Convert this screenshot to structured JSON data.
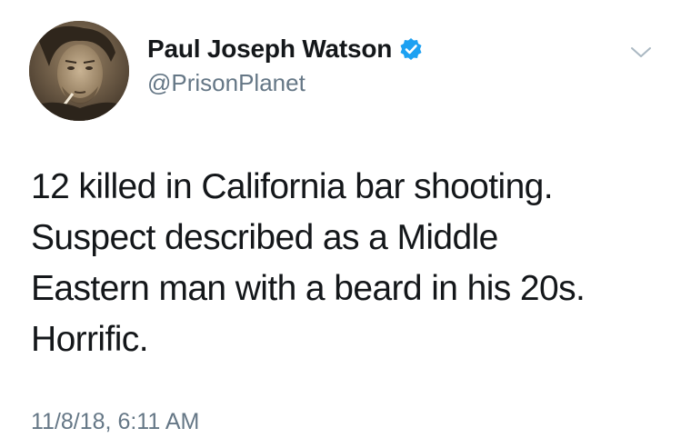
{
  "tweet": {
    "author": {
      "display_name": "Paul Joseph Watson",
      "handle": "@PrisonPlanet",
      "verified": true,
      "avatar_icon": "profile-photo"
    },
    "text_lines": [
      "12 killed in California bar shooting.",
      "Suspect described as a Middle",
      "Eastern man with a beard in his 20s.",
      "Horrific."
    ],
    "timestamp": "11/8/18, 6:11 AM",
    "menu_icon": "chevron-down-icon"
  },
  "colors": {
    "text_primary": "#14171a",
    "text_secondary": "#657786",
    "verified_blue": "#1da1f2",
    "chevron": "#aab8c2"
  }
}
